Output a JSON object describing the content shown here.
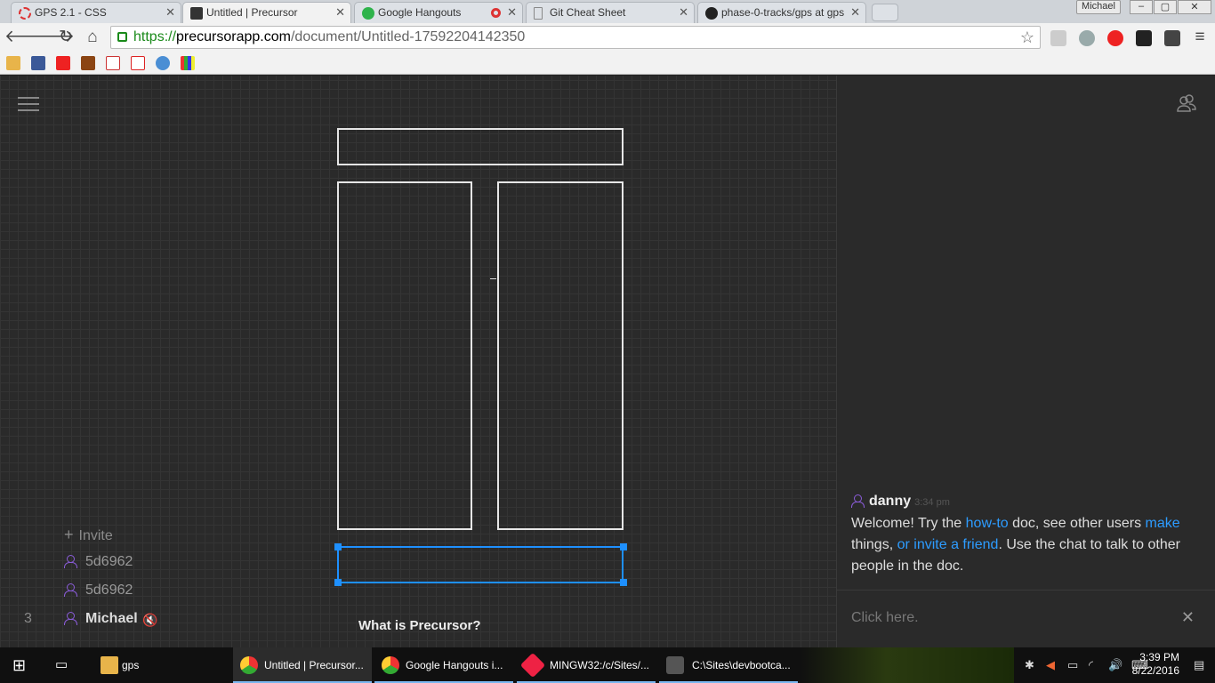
{
  "tabs": [
    {
      "title": "GPS 2.1 - CSS",
      "fav": "#d33"
    },
    {
      "title": "Untitled | Precursor",
      "fav": "#333"
    },
    {
      "title": "Google Hangouts",
      "fav": "#2eb34b"
    },
    {
      "title": "Git Cheat Sheet",
      "fav": "#aaa"
    },
    {
      "title": "phase-0-tracks/gps at gps",
      "fav": "#222"
    }
  ],
  "window": {
    "user": "Michael"
  },
  "url": {
    "scheme": "https://",
    "host": "precursorapp.com",
    "path": "/document/Untitled-17592204142350"
  },
  "canvas": {
    "invite_label": "Invite",
    "users": [
      "5d6962",
      "5d6962",
      "Michael"
    ],
    "user_count": "3",
    "what_is": "What is Precursor?"
  },
  "chat": {
    "author": "danny",
    "time": "3:34 pm",
    "text_1": "Welcome! Try the ",
    "link_howto": "how-to",
    "text_2": " doc, see other users ",
    "link_make": "make",
    "text_3": " things, ",
    "link_invite": "or invite a friend",
    "text_4": ". Use the chat to talk to other people in the doc.",
    "placeholder": "Click here."
  },
  "taskbar": {
    "items": [
      "gps",
      "Untitled | Precursor...",
      "Google Hangouts i...",
      "MINGW32:/c/Sites/...",
      "C:\\Sites\\devbootca..."
    ],
    "time": "3:39 PM",
    "date": "8/22/2016"
  }
}
